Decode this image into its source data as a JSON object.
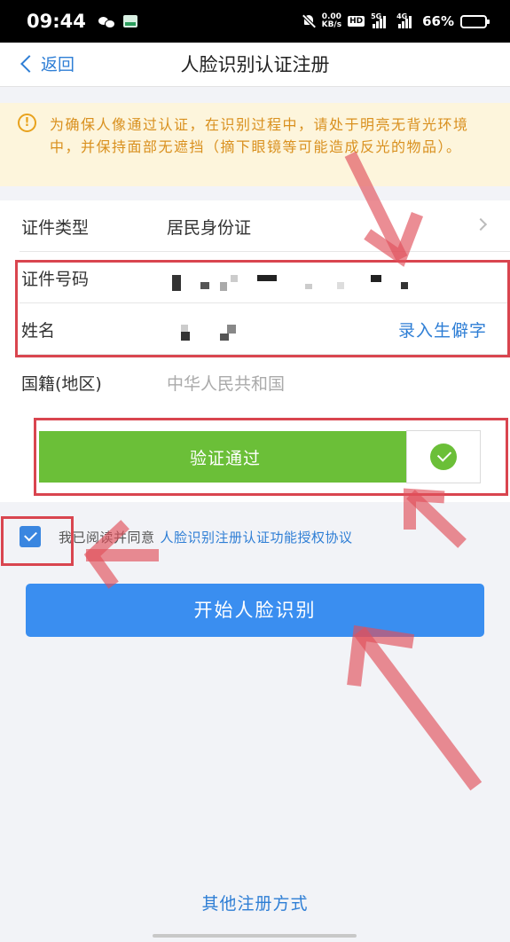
{
  "status_bar": {
    "time": "09:44",
    "net_speed_value": "0.00",
    "net_speed_unit": "KB/s",
    "hd_label": "HD",
    "sim1_label": "5G",
    "sim2_label": "4G",
    "battery_percent": "66%",
    "battery_level": 0.66
  },
  "nav": {
    "back_label": "返回",
    "title": "人脸识别认证注册"
  },
  "notice": {
    "text": "为确保人像通过认证，在识别过程中，请处于明亮无背光环境中，并保持面部无遮挡（摘下眼镜等可能造成反光的物品）。"
  },
  "form": {
    "id_type_label": "证件类型",
    "id_type_value": "居民身份证",
    "id_number_label": "证件号码",
    "name_label": "姓名",
    "rare_char_link": "录入生僻字",
    "nationality_label": "国籍(地区)",
    "nationality_value": "中华人民共和国"
  },
  "verify": {
    "text": "验证通过"
  },
  "agreement": {
    "prefix": "我已阅读并同意",
    "link": "人脸识别注册认证功能授权协议",
    "checked": true
  },
  "primary_button": {
    "label": "开始人脸识别"
  },
  "footer": {
    "other_methods_link": "其他注册方式"
  },
  "colors": {
    "accent_blue": "#3a8ef0",
    "verify_green": "#6bbf38",
    "annotation_red": "#d9454f",
    "notice_bg": "#fdf5dc",
    "notice_text": "#d9901e"
  }
}
